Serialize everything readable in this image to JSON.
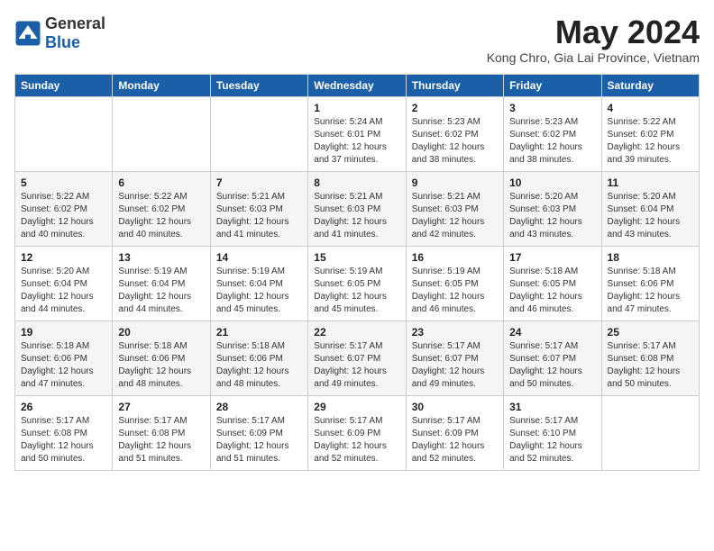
{
  "header": {
    "logo_general": "General",
    "logo_blue": "Blue",
    "month_year": "May 2024",
    "location": "Kong Chro, Gia Lai Province, Vietnam"
  },
  "days_of_week": [
    "Sunday",
    "Monday",
    "Tuesday",
    "Wednesday",
    "Thursday",
    "Friday",
    "Saturday"
  ],
  "weeks": [
    [
      {
        "day": "",
        "info": ""
      },
      {
        "day": "",
        "info": ""
      },
      {
        "day": "",
        "info": ""
      },
      {
        "day": "1",
        "info": "Sunrise: 5:24 AM\nSunset: 6:01 PM\nDaylight: 12 hours\nand 37 minutes."
      },
      {
        "day": "2",
        "info": "Sunrise: 5:23 AM\nSunset: 6:02 PM\nDaylight: 12 hours\nand 38 minutes."
      },
      {
        "day": "3",
        "info": "Sunrise: 5:23 AM\nSunset: 6:02 PM\nDaylight: 12 hours\nand 38 minutes."
      },
      {
        "day": "4",
        "info": "Sunrise: 5:22 AM\nSunset: 6:02 PM\nDaylight: 12 hours\nand 39 minutes."
      }
    ],
    [
      {
        "day": "5",
        "info": "Sunrise: 5:22 AM\nSunset: 6:02 PM\nDaylight: 12 hours\nand 40 minutes."
      },
      {
        "day": "6",
        "info": "Sunrise: 5:22 AM\nSunset: 6:02 PM\nDaylight: 12 hours\nand 40 minutes."
      },
      {
        "day": "7",
        "info": "Sunrise: 5:21 AM\nSunset: 6:03 PM\nDaylight: 12 hours\nand 41 minutes."
      },
      {
        "day": "8",
        "info": "Sunrise: 5:21 AM\nSunset: 6:03 PM\nDaylight: 12 hours\nand 41 minutes."
      },
      {
        "day": "9",
        "info": "Sunrise: 5:21 AM\nSunset: 6:03 PM\nDaylight: 12 hours\nand 42 minutes."
      },
      {
        "day": "10",
        "info": "Sunrise: 5:20 AM\nSunset: 6:03 PM\nDaylight: 12 hours\nand 43 minutes."
      },
      {
        "day": "11",
        "info": "Sunrise: 5:20 AM\nSunset: 6:04 PM\nDaylight: 12 hours\nand 43 minutes."
      }
    ],
    [
      {
        "day": "12",
        "info": "Sunrise: 5:20 AM\nSunset: 6:04 PM\nDaylight: 12 hours\nand 44 minutes."
      },
      {
        "day": "13",
        "info": "Sunrise: 5:19 AM\nSunset: 6:04 PM\nDaylight: 12 hours\nand 44 minutes."
      },
      {
        "day": "14",
        "info": "Sunrise: 5:19 AM\nSunset: 6:04 PM\nDaylight: 12 hours\nand 45 minutes."
      },
      {
        "day": "15",
        "info": "Sunrise: 5:19 AM\nSunset: 6:05 PM\nDaylight: 12 hours\nand 45 minutes."
      },
      {
        "day": "16",
        "info": "Sunrise: 5:19 AM\nSunset: 6:05 PM\nDaylight: 12 hours\nand 46 minutes."
      },
      {
        "day": "17",
        "info": "Sunrise: 5:18 AM\nSunset: 6:05 PM\nDaylight: 12 hours\nand 46 minutes."
      },
      {
        "day": "18",
        "info": "Sunrise: 5:18 AM\nSunset: 6:06 PM\nDaylight: 12 hours\nand 47 minutes."
      }
    ],
    [
      {
        "day": "19",
        "info": "Sunrise: 5:18 AM\nSunset: 6:06 PM\nDaylight: 12 hours\nand 47 minutes."
      },
      {
        "day": "20",
        "info": "Sunrise: 5:18 AM\nSunset: 6:06 PM\nDaylight: 12 hours\nand 48 minutes."
      },
      {
        "day": "21",
        "info": "Sunrise: 5:18 AM\nSunset: 6:06 PM\nDaylight: 12 hours\nand 48 minutes."
      },
      {
        "day": "22",
        "info": "Sunrise: 5:17 AM\nSunset: 6:07 PM\nDaylight: 12 hours\nand 49 minutes."
      },
      {
        "day": "23",
        "info": "Sunrise: 5:17 AM\nSunset: 6:07 PM\nDaylight: 12 hours\nand 49 minutes."
      },
      {
        "day": "24",
        "info": "Sunrise: 5:17 AM\nSunset: 6:07 PM\nDaylight: 12 hours\nand 50 minutes."
      },
      {
        "day": "25",
        "info": "Sunrise: 5:17 AM\nSunset: 6:08 PM\nDaylight: 12 hours\nand 50 minutes."
      }
    ],
    [
      {
        "day": "26",
        "info": "Sunrise: 5:17 AM\nSunset: 6:08 PM\nDaylight: 12 hours\nand 50 minutes."
      },
      {
        "day": "27",
        "info": "Sunrise: 5:17 AM\nSunset: 6:08 PM\nDaylight: 12 hours\nand 51 minutes."
      },
      {
        "day": "28",
        "info": "Sunrise: 5:17 AM\nSunset: 6:09 PM\nDaylight: 12 hours\nand 51 minutes."
      },
      {
        "day": "29",
        "info": "Sunrise: 5:17 AM\nSunset: 6:09 PM\nDaylight: 12 hours\nand 52 minutes."
      },
      {
        "day": "30",
        "info": "Sunrise: 5:17 AM\nSunset: 6:09 PM\nDaylight: 12 hours\nand 52 minutes."
      },
      {
        "day": "31",
        "info": "Sunrise: 5:17 AM\nSunset: 6:10 PM\nDaylight: 12 hours\nand 52 minutes."
      },
      {
        "day": "",
        "info": ""
      }
    ]
  ]
}
